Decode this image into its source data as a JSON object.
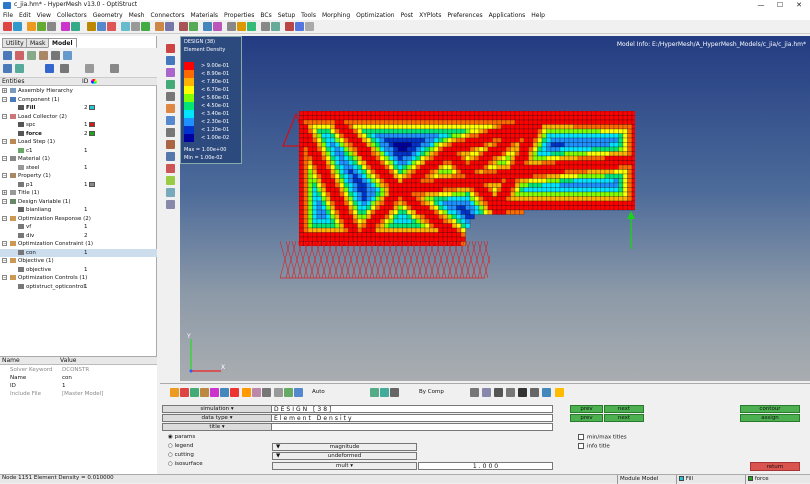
{
  "window": {
    "title": "c_jia.hm* - HyperMesh v13.0 - OptiStruct",
    "minimize": "—",
    "maximize": "☐",
    "close": "✕"
  },
  "menu": [
    "File",
    "Edit",
    "View",
    "Collectors",
    "Geometry",
    "Mesh",
    "Connectors",
    "Materials",
    "Properties",
    "BCs",
    "Setup",
    "Tools",
    "Morphing",
    "Optimization",
    "Post",
    "XYPlots",
    "Preferences",
    "Applications",
    "Help"
  ],
  "panel_tabs": [
    "Utility",
    "Mask",
    "Model"
  ],
  "tree_header": {
    "entities": "Entities",
    "id": "ID"
  },
  "tree": [
    {
      "label": "Assembly Hierarchy",
      "id": "",
      "level": 0,
      "exp": "+",
      "icon": "#7a9ac0"
    },
    {
      "label": "Component (1)",
      "id": "",
      "level": 0,
      "exp": "−",
      "icon": "#4a7ab8"
    },
    {
      "label": "Fill",
      "id": "2",
      "level": 2,
      "exp": "",
      "icon": "#555",
      "bold": true,
      "color": "#21c8d8"
    },
    {
      "label": "Load Collector (2)",
      "id": "",
      "level": 0,
      "exp": "−",
      "icon": "#c77"
    },
    {
      "label": "spc",
      "id": "1",
      "level": 2,
      "exp": "",
      "icon": "#555",
      "color": "#d41a1a"
    },
    {
      "label": "force",
      "id": "2",
      "level": 2,
      "exp": "",
      "icon": "#555",
      "bold": true,
      "color": "#18a818"
    },
    {
      "label": "Load Step (1)",
      "id": "",
      "level": 0,
      "exp": "−",
      "icon": "#b85"
    },
    {
      "label": "c1",
      "id": "1",
      "level": 2,
      "exp": "",
      "icon": "#6a6"
    },
    {
      "label": "Material (1)",
      "id": "",
      "level": 0,
      "exp": "−",
      "icon": "#888"
    },
    {
      "label": "steel",
      "id": "1",
      "level": 2,
      "exp": "",
      "icon": "#999"
    },
    {
      "label": "Property (1)",
      "id": "",
      "level": 0,
      "exp": "−",
      "icon": "#a86"
    },
    {
      "label": "p1",
      "id": "1",
      "level": 2,
      "exp": "",
      "icon": "#777",
      "color": "#8a8a8a"
    },
    {
      "label": "Title (1)",
      "id": "",
      "level": 0,
      "exp": "+",
      "icon": "#999"
    },
    {
      "label": "Design Variable (1)",
      "id": "",
      "level": 0,
      "exp": "−",
      "icon": "#686"
    },
    {
      "label": "bianliang",
      "id": "1",
      "level": 2,
      "exp": "",
      "icon": "#666"
    },
    {
      "label": "Optimization Response (2)",
      "id": "",
      "level": 0,
      "exp": "−",
      "icon": "#c95"
    },
    {
      "label": "vf",
      "id": "1",
      "level": 2,
      "exp": "",
      "icon": "#777"
    },
    {
      "label": "div",
      "id": "2",
      "level": 2,
      "exp": "",
      "icon": "#777"
    },
    {
      "label": "Optimization Constraint (1)",
      "id": "",
      "level": 0,
      "exp": "−",
      "icon": "#c95"
    },
    {
      "label": "con",
      "id": "1",
      "level": 2,
      "exp": "",
      "icon": "#777",
      "selected": true
    },
    {
      "label": "Objective (1)",
      "id": "",
      "level": 0,
      "exp": "−",
      "icon": "#c95"
    },
    {
      "label": "objective",
      "id": "1",
      "level": 2,
      "exp": "",
      "icon": "#777"
    },
    {
      "label": "Optimization Controls (1)",
      "id": "",
      "level": 0,
      "exp": "−",
      "icon": "#c95"
    },
    {
      "label": "optistruct_opticontrol",
      "id": "1",
      "level": 2,
      "exp": "",
      "icon": "#777"
    }
  ],
  "props_header": {
    "name": "Name",
    "value": "Value"
  },
  "props": [
    {
      "k": "Solver Keyword",
      "v": "DCONSTR",
      "dim": true
    },
    {
      "k": "Name",
      "v": "con"
    },
    {
      "k": "ID",
      "v": "1"
    },
    {
      "k": "Include File",
      "v": "[Master Model]",
      "dim": true
    }
  ],
  "viewport": {
    "model_info": "Model Info: E:/HyperMesh/A_HyperMesh_Models/c_jia/c_jia.hm*",
    "legend_title1": "DESIGN (38)",
    "legend_title2": "Element Density",
    "legend_entries": [
      "> 9.00e-01",
      "< 8.90e-01",
      "< 7.80e-01",
      "< 6.70e-01",
      "< 5.60e-01",
      "< 4.50e-01",
      "< 3.40e-01",
      "< 2.30e-01",
      "< 1.20e-01",
      "< 1.00e-02"
    ],
    "legend_colors": [
      "#ff0000",
      "#ff6a00",
      "#ffb300",
      "#ffff00",
      "#7fff00",
      "#00e676",
      "#00e5ff",
      "#1e90ff",
      "#0033cc",
      "#0000a0"
    ],
    "legend_max": "Max = 1.00e+00",
    "legend_min": "Min = 1.00e-02",
    "axis_y": "Y",
    "axis_x": "X"
  },
  "bottom": {
    "auto_label": "Auto",
    "bycomp_label": "By Comp",
    "simulation_label": "simulation",
    "datatype_label": "data type",
    "title_label": "title",
    "simulation_value": "DESIGN [38]",
    "datatype_value": "Element Density",
    "prev": "prev",
    "next": "next",
    "contour": "contour",
    "assign": "assign",
    "params": "params",
    "legend": "legend",
    "cutting": "cutting",
    "isosurface": "isosurface",
    "magnitude": "magnitude",
    "undeformed": "undeformed",
    "mult": "mult",
    "scale_value": "1.000",
    "minmax_titles": "min/max titles",
    "info_title": "info title",
    "return": "return"
  },
  "status": {
    "left": "Node 1151 Element Density = 0.010000",
    "module": "Module Model",
    "comp": "Fill",
    "loadcol": "force"
  }
}
